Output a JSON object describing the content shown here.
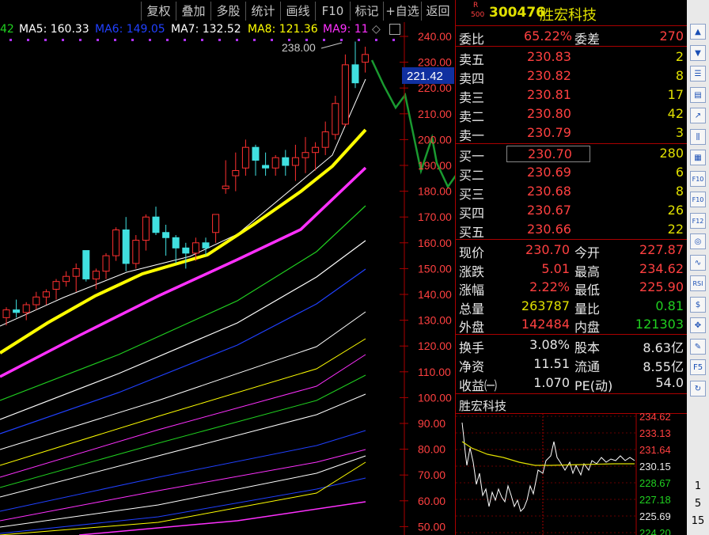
{
  "toolbar": {
    "buttons": [
      "复权",
      "叠加",
      "多股",
      "统计",
      "画线",
      "F10",
      "标记",
      "+自选",
      "返回"
    ]
  },
  "ma_legend": [
    {
      "label": "42",
      "color": "#20d020"
    },
    {
      "label": "MA5: 160.33",
      "color": "#ffffff"
    },
    {
      "label": "MA6: 149.05",
      "color": "#2040ff"
    },
    {
      "label": "MA7: 132.52",
      "color": "#ffffff"
    },
    {
      "label": "MA8: 121.36",
      "color": "#ffff00"
    },
    {
      "label": "MA9: 11",
      "color": "#ff30ff"
    }
  ],
  "chart": {
    "high_marker": "238.00",
    "current_price_label": "221.42",
    "price_axis": [
      "240.00",
      "230.00",
      "220.00",
      "210.00",
      "200.00",
      "190.00",
      "180.00",
      "170.00",
      "160.00",
      "150.00",
      "140.00",
      "130.00",
      "120.00",
      "110.00",
      "100.00",
      "90.00",
      "80.00",
      "70.00",
      "60.00",
      "50.00"
    ]
  },
  "chart_data": {
    "type": "candlestick",
    "ylim": [
      45,
      245
    ],
    "ma_lines": [
      {
        "name": "MA5",
        "color": "#ffffff"
      },
      {
        "name": "MA6",
        "color": "#2040ff"
      },
      {
        "name": "MA7",
        "color": "#ffffff"
      },
      {
        "name": "MA8",
        "color": "#ffff00"
      },
      {
        "name": "MA9",
        "color": "#ff30ff"
      }
    ]
  },
  "quote": {
    "code": "300476",
    "name": "胜宏科技",
    "badge_top": "R",
    "badge_bottom": "500",
    "weibi_label": "委比",
    "weibi": "65.22%",
    "weicha_label": "委差",
    "weicha": "270",
    "asks": [
      {
        "label": "卖五",
        "price": "230.83",
        "vol": "2"
      },
      {
        "label": "卖四",
        "price": "230.82",
        "vol": "8"
      },
      {
        "label": "卖三",
        "price": "230.81",
        "vol": "17"
      },
      {
        "label": "卖二",
        "price": "230.80",
        "vol": "42"
      },
      {
        "label": "卖一",
        "price": "230.79",
        "vol": "3"
      }
    ],
    "bids": [
      {
        "label": "买一",
        "price": "230.70",
        "vol": "280"
      },
      {
        "label": "买二",
        "price": "230.69",
        "vol": "6"
      },
      {
        "label": "买三",
        "price": "230.68",
        "vol": "8"
      },
      {
        "label": "买四",
        "price": "230.67",
        "vol": "26"
      },
      {
        "label": "买五",
        "price": "230.66",
        "vol": "22"
      }
    ],
    "stats": [
      {
        "l1": "现价",
        "v1": "230.70",
        "c1": "red",
        "l2": "今开",
        "v2": "227.87",
        "c2": "red"
      },
      {
        "l1": "涨跌",
        "v1": "5.01",
        "c1": "red",
        "l2": "最高",
        "v2": "234.62",
        "c2": "red"
      },
      {
        "l1": "涨幅",
        "v1": "2.22%",
        "c1": "red",
        "l2": "最低",
        "v2": "225.90",
        "c2": "red"
      },
      {
        "l1": "总量",
        "v1": "263787",
        "c1": "yellow",
        "l2": "量比",
        "v2": "0.81",
        "c2": "green"
      },
      {
        "l1": "外盘",
        "v1": "142484",
        "c1": "red",
        "l2": "内盘",
        "v2": "121303",
        "c2": "green"
      }
    ],
    "fundamentals": [
      {
        "l1": "换手",
        "v1": "3.08%",
        "l2": "股本",
        "v2": "8.63亿"
      },
      {
        "l1": "净资",
        "v1": "11.51",
        "l2": "流通",
        "v2": "8.55亿"
      },
      {
        "l1": "收益㈠",
        "v1": "1.070",
        "l2": "PE(动)",
        "v2": "54.0"
      }
    ],
    "mini_title": "胜宏科技",
    "mini_axis": [
      "234.62",
      "233.13",
      "231.64",
      "230.15",
      "228.67",
      "227.18",
      "225.69",
      "224.20"
    ]
  },
  "side_toolbar": {
    "icons": [
      "arrow-up-icon",
      "arrow-down-icon",
      "list-icon",
      "tick-icon",
      "trend-icon",
      "kline-icon",
      "doc-icon",
      "f10-icon",
      "f10b-icon",
      "f12-icon",
      "circle-icon",
      "wave-icon",
      "rsi-icon",
      "dollar-icon",
      "move-icon",
      "pencil-icon",
      "f5-icon",
      "refresh-icon"
    ],
    "numbers": [
      "1",
      "5",
      "15"
    ]
  }
}
